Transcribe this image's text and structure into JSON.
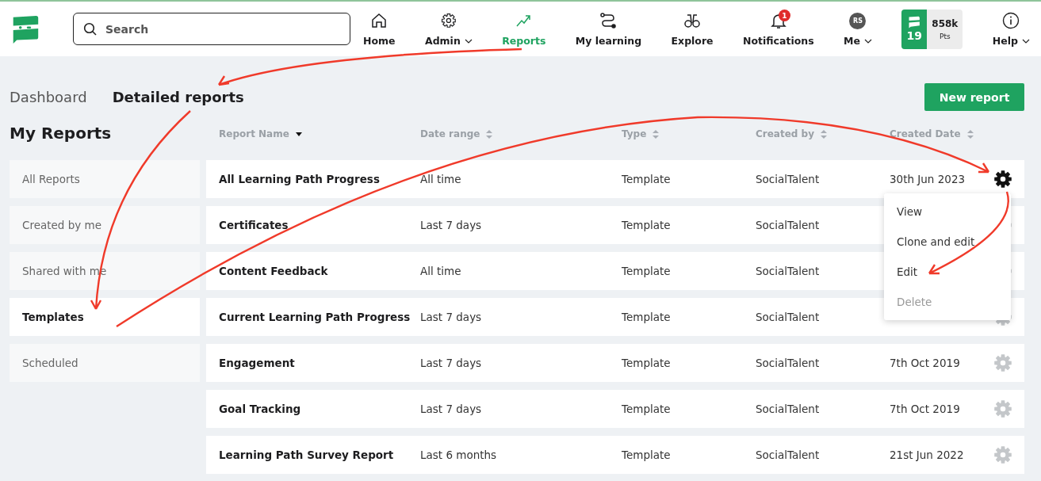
{
  "search": {
    "placeholder": "Search"
  },
  "nav": [
    {
      "label": "Home",
      "selected": false,
      "dropdown": false
    },
    {
      "label": "Admin",
      "selected": false,
      "dropdown": true
    },
    {
      "label": "Reports",
      "selected": true,
      "dropdown": false
    },
    {
      "label": "My learning",
      "selected": false,
      "dropdown": false
    },
    {
      "label": "Explore",
      "selected": false,
      "dropdown": false
    },
    {
      "label": "Notifications",
      "selected": false,
      "dropdown": false,
      "badge": "1"
    },
    {
      "label": "Me",
      "selected": false,
      "dropdown": true,
      "avatar": "RS"
    }
  ],
  "points": {
    "level_number": "19",
    "value": "858k",
    "unit": "Pts"
  },
  "help": {
    "label": "Help",
    "dropdown": true
  },
  "tabs": [
    {
      "label": "Dashboard",
      "selected": false
    },
    {
      "label": "Detailed reports",
      "selected": true
    }
  ],
  "new_report_button": "New report",
  "sidebar": {
    "title": "My Reports",
    "items": [
      {
        "label": "All Reports",
        "selected": false
      },
      {
        "label": "Created by me",
        "selected": false
      },
      {
        "label": "Shared with me",
        "selected": false
      },
      {
        "label": "Templates",
        "selected": true
      },
      {
        "label": "Scheduled",
        "selected": false
      }
    ]
  },
  "table": {
    "columns": [
      {
        "label": "Report Name",
        "sorted": true
      },
      {
        "label": "Date range",
        "sorted": false
      },
      {
        "label": "Type",
        "sorted": false
      },
      {
        "label": "Created by",
        "sorted": false
      },
      {
        "label": "Created Date",
        "sorted": false
      }
    ],
    "rows": [
      {
        "name": "All Learning Path Progress",
        "date_range": "All time",
        "type": "Template",
        "created_by": "SocialTalent",
        "created_date": "30th Jun 2023",
        "menu_open": true
      },
      {
        "name": "Certificates",
        "date_range": "Last 7 days",
        "type": "Template",
        "created_by": "SocialTalent",
        "menu_open": false
      },
      {
        "name": "Content Feedback",
        "date_range": "All time",
        "type": "Template",
        "created_by": "SocialTalent",
        "menu_open": false
      },
      {
        "name": "Current Learning Path Progress",
        "date_range": "Last 7 days",
        "type": "Template",
        "created_by": "SocialTalent",
        "menu_open": false
      },
      {
        "name": "Engagement",
        "date_range": "Last 7 days",
        "type": "Template",
        "created_by": "SocialTalent",
        "created_date": "7th Oct 2019",
        "menu_open": false
      },
      {
        "name": "Goal Tracking",
        "date_range": "Last 7 days",
        "type": "Template",
        "created_by": "SocialTalent",
        "created_date": "7th Oct 2019",
        "menu_open": false
      },
      {
        "name": "Learning Path Survey Report",
        "date_range": "Last 6 months",
        "type": "Template",
        "created_by": "SocialTalent",
        "created_date": "21st Jun 2022",
        "menu_open": false
      }
    ]
  },
  "context_menu": [
    {
      "label": "View",
      "disabled": false
    },
    {
      "label": "Clone and edit",
      "disabled": false
    },
    {
      "label": "Edit",
      "disabled": false
    },
    {
      "label": "Delete",
      "disabled": true
    }
  ]
}
